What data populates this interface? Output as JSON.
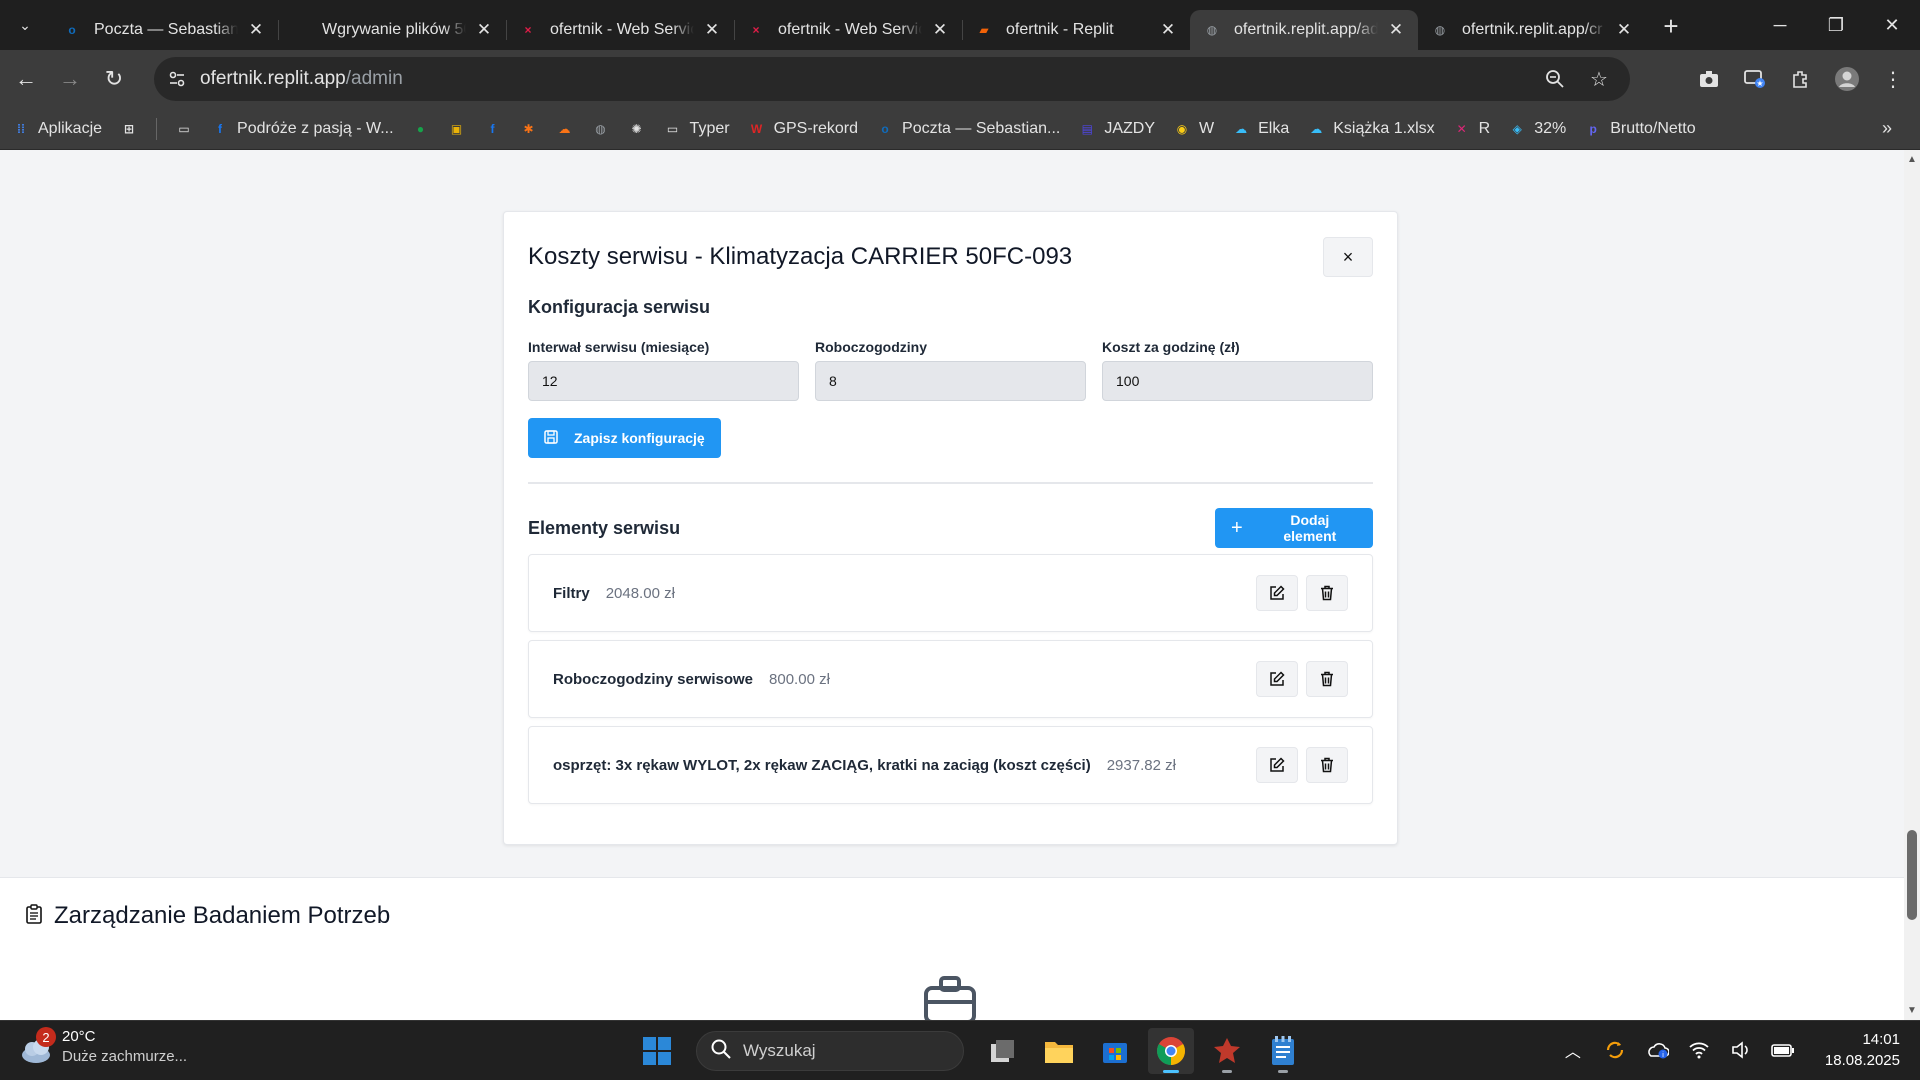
{
  "browser": {
    "tabs": [
      {
        "title": "Poczta — Sebastian P",
        "icon_color": "#0f6cbd",
        "icon_text": "o"
      },
      {
        "title": "Wgrywanie plików 50",
        "icon_color": "#1f1f1f",
        "icon_text": ""
      },
      {
        "title": "ofertnik - Web Servic",
        "icon_color": "#e11d48",
        "icon_text": "×"
      },
      {
        "title": "ofertnik - Web Servic",
        "icon_color": "#e11d48",
        "icon_text": "×"
      },
      {
        "title": "ofertnik - Replit",
        "icon_color": "#f26207",
        "icon_text": "▰"
      },
      {
        "title": "ofertnik.replit.app/ad",
        "icon_color": "#9aa0a6",
        "icon_text": "◍"
      },
      {
        "title": "ofertnik.replit.app/cr",
        "icon_color": "#9aa0a6",
        "icon_text": "◍"
      }
    ],
    "url_host": "ofertnik.replit.app",
    "url_path": "/admin",
    "bookmarks": [
      {
        "label": "Aplikacje",
        "icon": "apps-grid",
        "color": "#4285f4"
      },
      {
        "label": "",
        "icon": "grid",
        "color": "#e3e3e3"
      },
      {
        "label": "",
        "icon": "folder",
        "color": "#e3e3e3"
      },
      {
        "label": "Podróże z pasją - W...",
        "icon": "facebook",
        "color": "#1877f2"
      },
      {
        "label": "",
        "icon": "circle-green",
        "color": "#16a34a"
      },
      {
        "label": "",
        "icon": "briefcase",
        "color": "#eab308"
      },
      {
        "label": "",
        "icon": "facebook",
        "color": "#1877f2"
      },
      {
        "label": "",
        "icon": "hubspot",
        "color": "#f97316"
      },
      {
        "label": "",
        "icon": "cloud",
        "color": "#f97316"
      },
      {
        "label": "",
        "icon": "globe",
        "color": "#9aa0a6"
      },
      {
        "label": "",
        "icon": "openai",
        "color": "#e3e3e3"
      },
      {
        "label": "Typer",
        "icon": "folder",
        "color": "#e3e3e3"
      },
      {
        "label": "GPS-rekord",
        "icon": "gps",
        "color": "#dc2626"
      },
      {
        "label": "Poczta — Sebastian...",
        "icon": "outlook",
        "color": "#0f6cbd"
      },
      {
        "label": "JAZDY",
        "icon": "calendar",
        "color": "#4f46e5"
      },
      {
        "label": "W",
        "icon": "chrome",
        "color": "#facc15"
      },
      {
        "label": "Elka",
        "icon": "onedrive",
        "color": "#38bdf8"
      },
      {
        "label": "Książka 1.xlsx",
        "icon": "onedrive",
        "color": "#38bdf8"
      },
      {
        "label": "R",
        "icon": "r-icon",
        "color": "#db2777"
      },
      {
        "label": "32%",
        "icon": "bulb",
        "color": "#38bdf8"
      },
      {
        "label": "Brutto/Netto",
        "icon": "p-icon",
        "color": "#6366f1"
      }
    ]
  },
  "modal": {
    "title": "Koszty serwisu - Klimatyzacja CARRIER 50FC-093",
    "close_label": "×",
    "config": {
      "title": "Konfiguracja serwisu",
      "interval_label": "Interwał serwisu (miesiące)",
      "interval_value": "12",
      "hours_label": "Roboczogodziny",
      "hours_value": "8",
      "rate_label": "Koszt za godzinę (zł)",
      "rate_value": "100",
      "save_label": "Zapisz konfigurację"
    },
    "elements": {
      "title": "Elementy serwisu",
      "add_label": "Dodaj element",
      "items": [
        {
          "name": "Filtry",
          "cost": "2048.00 zł"
        },
        {
          "name": "Roboczogodziny serwisowe",
          "cost": "800.00 zł"
        },
        {
          "name": "osprzęt: 3x rękaw WYLOT, 2x rękaw ZACIĄG, kratki na zaciąg (koszt części)",
          "cost": "2937.82 zł"
        }
      ]
    }
  },
  "section2": {
    "title": "Zarządzanie Badaniem Potrzeb"
  },
  "taskbar": {
    "weather_badge": "2",
    "temperature": "20°C",
    "weather_desc": "Duże zachmurze...",
    "search_placeholder": "Wyszukaj",
    "time": "14:01",
    "date": "18.08.2025"
  }
}
